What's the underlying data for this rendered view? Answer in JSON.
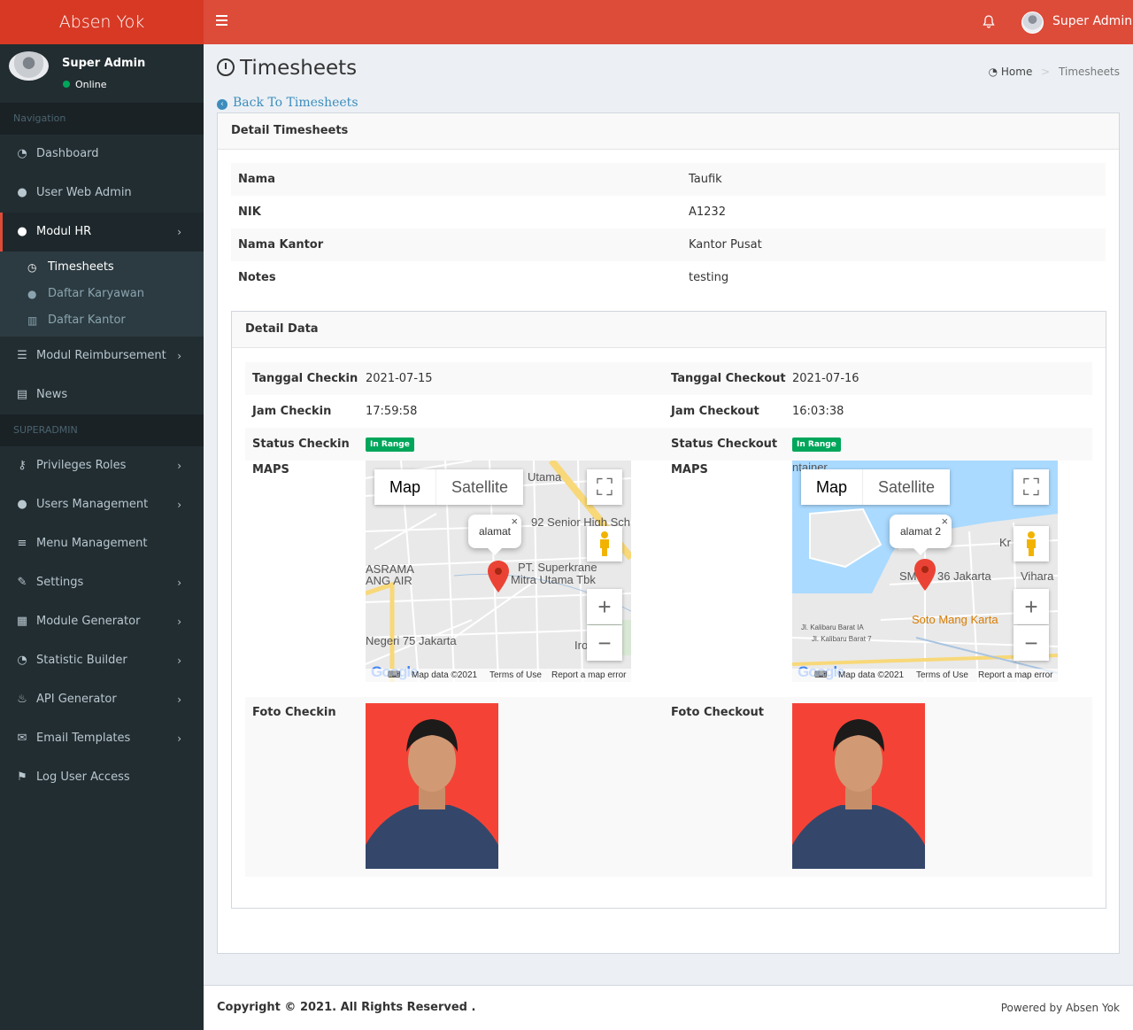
{
  "app": {
    "logo": "Absen Yok"
  },
  "topbar": {
    "user_name": "Super Admin"
  },
  "sidebar": {
    "user": {
      "name": "Super Admin",
      "status": "Online"
    },
    "header_navigation": "Navigation",
    "header_superadmin": "SUPERADMIN",
    "items": [
      {
        "label": "Dashboard",
        "icon": "dashboard-icon"
      },
      {
        "label": "User Web Admin",
        "icon": "user-icon"
      },
      {
        "label": "Modul HR",
        "icon": "users-icon"
      },
      {
        "label": "Modul Reimbursement",
        "icon": "list-icon"
      },
      {
        "label": "News",
        "icon": "newspaper-icon"
      },
      {
        "label": "Privileges Roles",
        "icon": "key-icon"
      },
      {
        "label": "Users Management",
        "icon": "users-icon"
      },
      {
        "label": "Menu Management",
        "icon": "bars-icon"
      },
      {
        "label": "Settings",
        "icon": "wrench-icon"
      },
      {
        "label": "Module Generator",
        "icon": "th-icon"
      },
      {
        "label": "Statistic Builder",
        "icon": "dashboard-icon"
      },
      {
        "label": "API Generator",
        "icon": "fire-icon"
      },
      {
        "label": "Email Templates",
        "icon": "envelope-icon"
      },
      {
        "label": "Log User Access",
        "icon": "flag-icon"
      }
    ],
    "submenu": [
      {
        "label": "Timesheets",
        "icon": "clock-icon"
      },
      {
        "label": "Daftar Karyawan",
        "icon": "users-icon"
      },
      {
        "label": "Daftar Kantor",
        "icon": "building-icon"
      }
    ]
  },
  "page": {
    "title": "Timesheets",
    "breadcrumb": {
      "home": "Home",
      "current": "Timesheets"
    },
    "back_link": "Back To Timesheets"
  },
  "detail": {
    "title": "Detail Timesheets",
    "rows": [
      {
        "label": "Nama",
        "value": "Taufik"
      },
      {
        "label": "NIK",
        "value": "A1232"
      },
      {
        "label": "Nama Kantor",
        "value": "Kantor Pusat"
      },
      {
        "label": "Notes",
        "value": "testing"
      }
    ]
  },
  "detail_data": {
    "title": "Detail Data",
    "checkin": {
      "tanggal_label": "Tanggal Checkin",
      "tanggal": "2021-07-15",
      "jam_label": "Jam Checkin",
      "jam": "17:59:58",
      "status_label": "Status Checkin",
      "status": "In Range",
      "maps_label": "MAPS",
      "foto_label": "Foto Checkin",
      "map": {
        "info": "alamat",
        "labels": [
          "Utama",
          "92 Senior High Sch",
          "PT. Superkrane",
          "Mitra Utama Tbk",
          "ASRAMA",
          "ANG AIR",
          "Negeri 75 Jakarta",
          "Iro"
        ]
      }
    },
    "checkout": {
      "tanggal_label": "Tanggal Checkout",
      "tanggal": "2021-07-16",
      "jam_label": "Jam Checkout",
      "jam": "16:03:38",
      "status_label": "Status Checkout",
      "status": "In Range",
      "maps_label": "MAPS",
      "foto_label": "Foto Checkout",
      "map": {
        "info": "alamat 2",
        "labels": [
          "ntainer",
          "Kr",
          "SM",
          "36 Jakarta",
          "Vihara",
          "Soto Mang Karta",
          "Jl. Kalibaru Barat IA",
          "Jl. Kalibaru Barat 7"
        ]
      }
    },
    "map_ui": {
      "map": "Map",
      "satellite": "Satellite",
      "map_data": "Map data ©2021",
      "terms": "Terms of Use",
      "report": "Report a map error",
      "google": "Google"
    },
    "badge_color": "#00a65a"
  },
  "footer": {
    "copyright": "Copyright © 2021. All Rights Reserved .",
    "powered": "Powered by Absen Yok"
  }
}
